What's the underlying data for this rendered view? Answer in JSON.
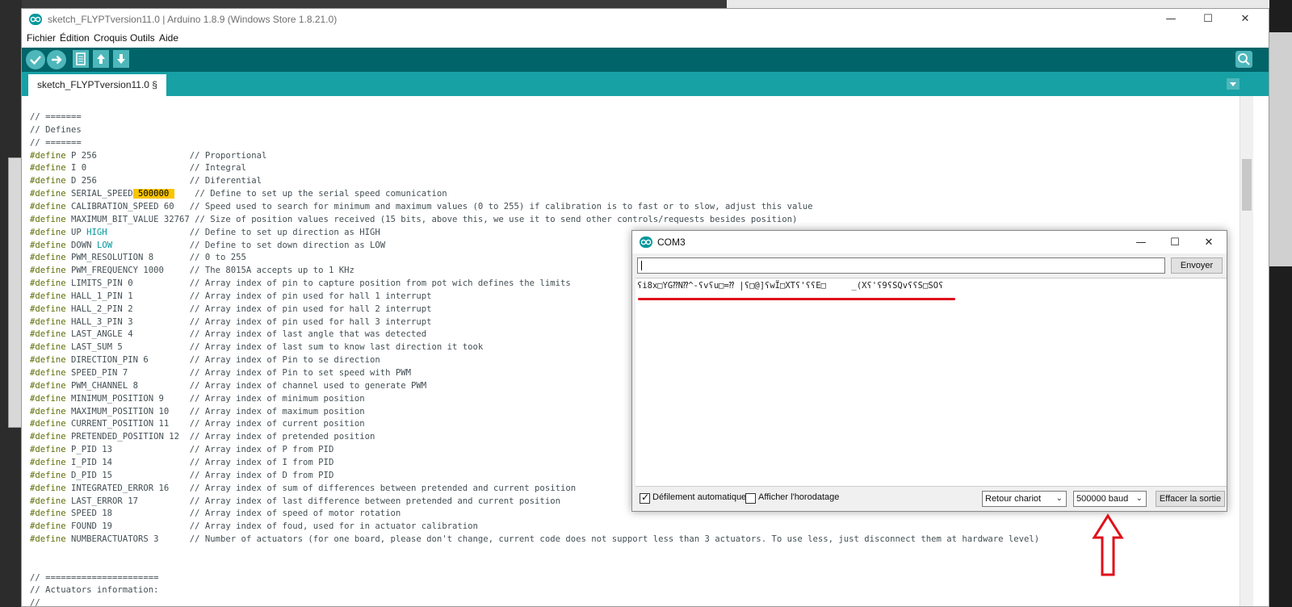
{
  "window": {
    "title": "sketch_FLYPTversion11.0 | Arduino 1.8.9 (Windows Store 1.8.21.0)",
    "minimize": "—",
    "maximize": "☐",
    "close": "✕"
  },
  "menu": [
    "Fichier",
    "Édition",
    "Croquis",
    "Outils",
    "Aide"
  ],
  "tab": {
    "label": "sketch_FLYPTversion11.0 §"
  },
  "code": [
    {
      "kw": "",
      "pre": "",
      "hi": "",
      "post": "// ======="
    },
    {
      "kw": "",
      "pre": "",
      "hi": "",
      "post": "// Defines"
    },
    {
      "kw": "",
      "pre": "",
      "hi": "",
      "post": "// ======="
    },
    {
      "kw": "#define",
      "pre": " P 256                  ",
      "hi": "",
      "post": "// Proportional"
    },
    {
      "kw": "#define",
      "pre": " I 0                    ",
      "hi": "",
      "post": "// Integral"
    },
    {
      "kw": "#define",
      "pre": " D 256                  ",
      "hi": "",
      "post": "// Diferential"
    },
    {
      "kw": "#define",
      "pre": " SERIAL_SPEED",
      "hi": " 500000 ",
      "post": "    // Define to set up the serial speed comunication"
    },
    {
      "kw": "#define",
      "pre": " CALIBRATION_SPEED 60   ",
      "hi": "",
      "post": "// Speed used to search for minimum and maximum values (0 to 255) if calibration is to fast or to slow, adjust this value"
    },
    {
      "kw": "#define",
      "pre": " MAXIMUM_BIT_VALUE 32767 ",
      "hi": "",
      "post": "// Size of position values received (15 bits, above this, we use it to send other controls/requests besides position)"
    },
    {
      "kw": "#define",
      "pre": " UP ",
      "cst": "HIGH",
      "post2": "                ",
      "hi": "",
      "post": "// Define to set up direction as HIGH"
    },
    {
      "kw": "#define",
      "pre": " DOWN ",
      "cst": "LOW",
      "post2": "               ",
      "hi": "",
      "post": "// Define to set down direction as LOW"
    },
    {
      "kw": "#define",
      "pre": " PWM_RESOLUTION 8       ",
      "hi": "",
      "post": "// 0 to 255"
    },
    {
      "kw": "#define",
      "pre": " PWM_FREQUENCY 1000     ",
      "hi": "",
      "post": "// The 8015A accepts up to 1 KHz"
    },
    {
      "kw": "#define",
      "pre": " LIMITS_PIN 0           ",
      "hi": "",
      "post": "// Array index of pin to capture position from pot wich defines the limits"
    },
    {
      "kw": "#define",
      "pre": " HALL_1_PIN 1           ",
      "hi": "",
      "post": "// Array index of pin used for hall 1 interrupt"
    },
    {
      "kw": "#define",
      "pre": " HALL_2_PIN 2           ",
      "hi": "",
      "post": "// Array index of pin used for hall 2 interrupt"
    },
    {
      "kw": "#define",
      "pre": " HALL_3_PIN 3           ",
      "hi": "",
      "post": "// Array index of pin used for hall 3 interrupt"
    },
    {
      "kw": "#define",
      "pre": " LAST_ANGLE 4           ",
      "hi": "",
      "post": "// Array index of last angle that was detected"
    },
    {
      "kw": "#define",
      "pre": " LAST_SUM 5             ",
      "hi": "",
      "post": "// Array index of last sum to know last direction it took"
    },
    {
      "kw": "#define",
      "pre": " DIRECTION_PIN 6        ",
      "hi": "",
      "post": "// Array index of Pin to se direction"
    },
    {
      "kw": "#define",
      "pre": " SPEED_PIN 7            ",
      "hi": "",
      "post": "// Array index of Pin to set speed with PWM"
    },
    {
      "kw": "#define",
      "pre": " PWM_CHANNEL 8          ",
      "hi": "",
      "post": "// Array index of channel used to generate PWM"
    },
    {
      "kw": "#define",
      "pre": " MINIMUM_POSITION 9     ",
      "hi": "",
      "post": "// Array index of minimum position"
    },
    {
      "kw": "#define",
      "pre": " MAXIMUM_POSITION 10    ",
      "hi": "",
      "post": "// Array index of maximum position"
    },
    {
      "kw": "#define",
      "pre": " CURRENT_POSITION 11    ",
      "hi": "",
      "post": "// Array index of current position"
    },
    {
      "kw": "#define",
      "pre": " PRETENDED_POSITION 12  ",
      "hi": "",
      "post": "// Array index of pretended position"
    },
    {
      "kw": "#define",
      "pre": " P_PID 13               ",
      "hi": "",
      "post": "// Array index of P from PID"
    },
    {
      "kw": "#define",
      "pre": " I_PID 14               ",
      "hi": "",
      "post": "// Array index of I from PID"
    },
    {
      "kw": "#define",
      "pre": " D_PID 15               ",
      "hi": "",
      "post": "// Array index of D from PID"
    },
    {
      "kw": "#define",
      "pre": " INTEGRATED_ERROR 16    ",
      "hi": "",
      "post": "// Array index of sum of differences between pretended and current position"
    },
    {
      "kw": "#define",
      "pre": " LAST_ERROR 17          ",
      "hi": "",
      "post": "// Array index of last difference between pretended and current position"
    },
    {
      "kw": "#define",
      "pre": " SPEED 18               ",
      "hi": "",
      "post": "// Array index of speed of motor rotation"
    },
    {
      "kw": "#define",
      "pre": " FOUND 19               ",
      "hi": "",
      "post": "// Array index of foud, used for in actuator calibration"
    },
    {
      "kw": "#define",
      "pre": " NUMBERACTUATORS 3      ",
      "hi": "",
      "post": "// Number of actuators (for one board, please don't change, current code does not support less than 3 actuators. To use less, just disconnect them at hardware level)"
    },
    {
      "kw": "",
      "pre": "",
      "hi": "",
      "post": ""
    },
    {
      "kw": "",
      "pre": "",
      "hi": "",
      "post": ""
    },
    {
      "kw": "",
      "pre": "",
      "hi": "",
      "post": "// ======================"
    },
    {
      "kw": "",
      "pre": "",
      "hi": "",
      "post": "// Actuators information:"
    },
    {
      "kw": "",
      "pre": "",
      "hi": "",
      "post": "//"
    }
  ],
  "serial_monitor": {
    "title": "COM3",
    "send_input_value": "",
    "send_label": "Envoyer",
    "output": "ʕi8x□YG⁇N⁇^-ʕvʕu□=⁇ |ʕ□@]ʕwÏ□XTʕ'ʕʕE□     _(Xʕ'ʕ9ʕSQvʕʕS□SOʕ",
    "autoscroll_label": "Défilement automatique",
    "autoscroll_checked": "✓",
    "timestamp_label": "Afficher l'horodatage",
    "line_ending": "Retour chariot",
    "baud": "500000  baud",
    "clear_label": "Effacer la sortie"
  },
  "colors": {
    "toolbar": "#006468",
    "tabbar": "#17a1a5",
    "button": "#4db7bb",
    "keyword": "#5e6d03",
    "highlight": "#f9c400",
    "annotation": "#e0101a"
  }
}
